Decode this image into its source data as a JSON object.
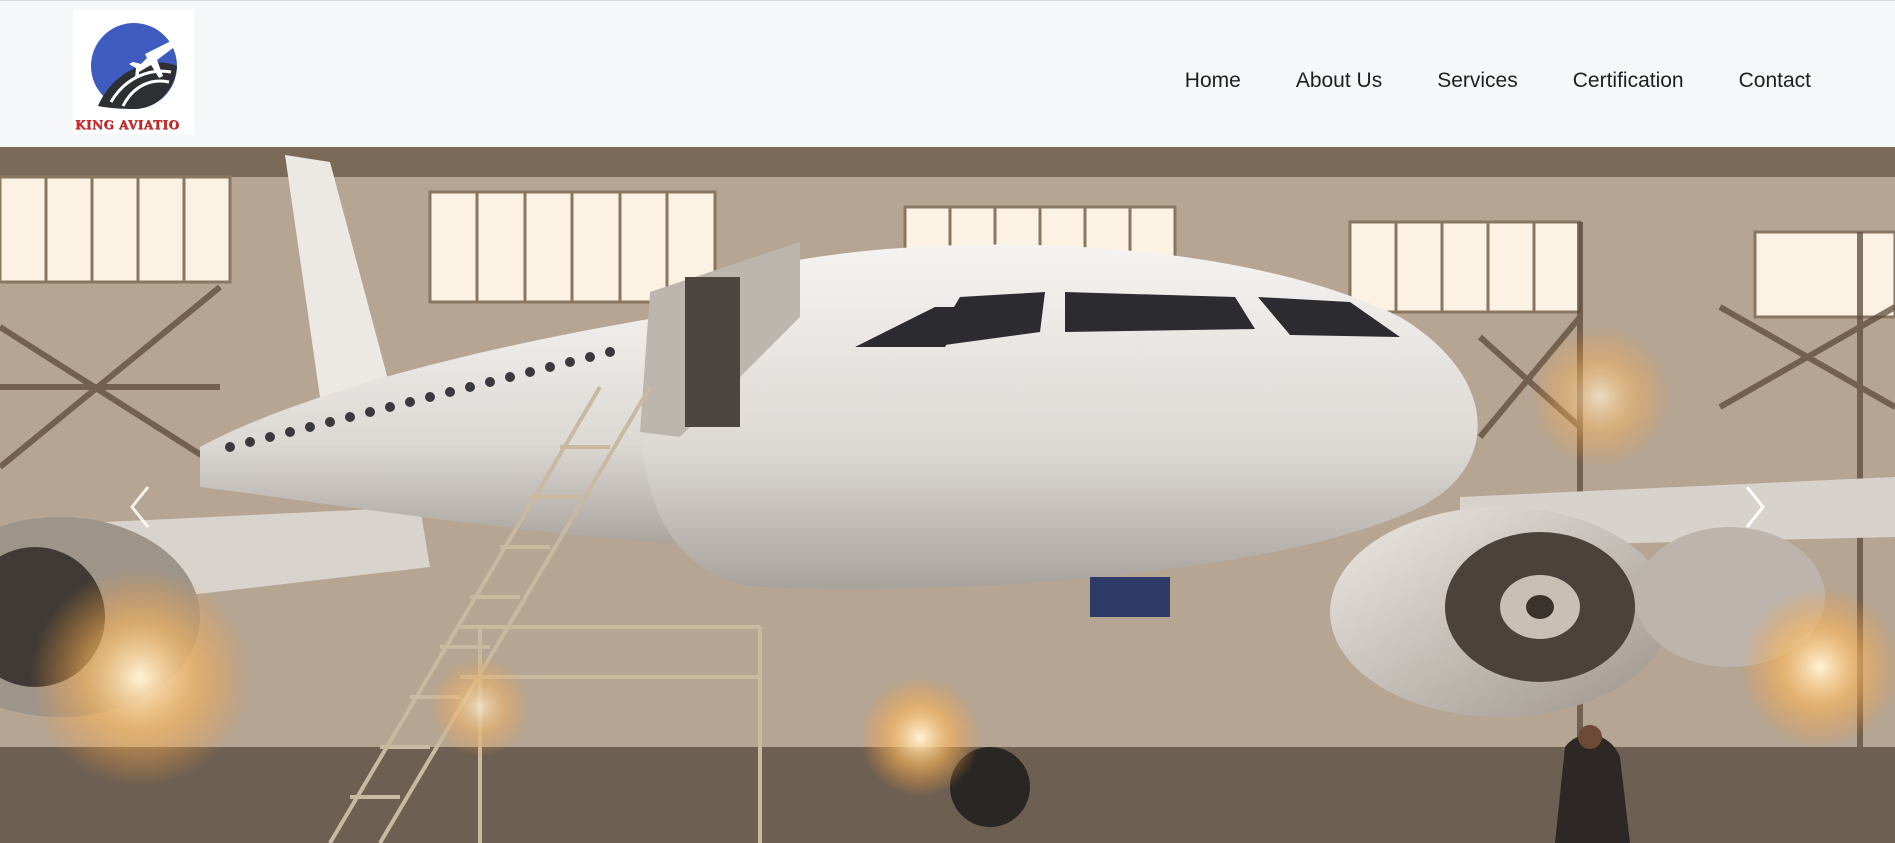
{
  "brand": {
    "logo_text": "KING AVIATIO",
    "colors": {
      "logo_blue": "#3e5bbf",
      "logo_text_red": "#d12a2a"
    },
    "icon": "plane-globe-logo"
  },
  "nav": {
    "items": [
      {
        "label": "Home"
      },
      {
        "label": "About Us"
      },
      {
        "label": "Services"
      },
      {
        "label": "Certification"
      },
      {
        "label": "Contact"
      }
    ]
  },
  "hero": {
    "image": "aircraft-in-hangar-photo",
    "prev_icon": "chevron-left-icon",
    "next_icon": "chevron-right-icon"
  }
}
